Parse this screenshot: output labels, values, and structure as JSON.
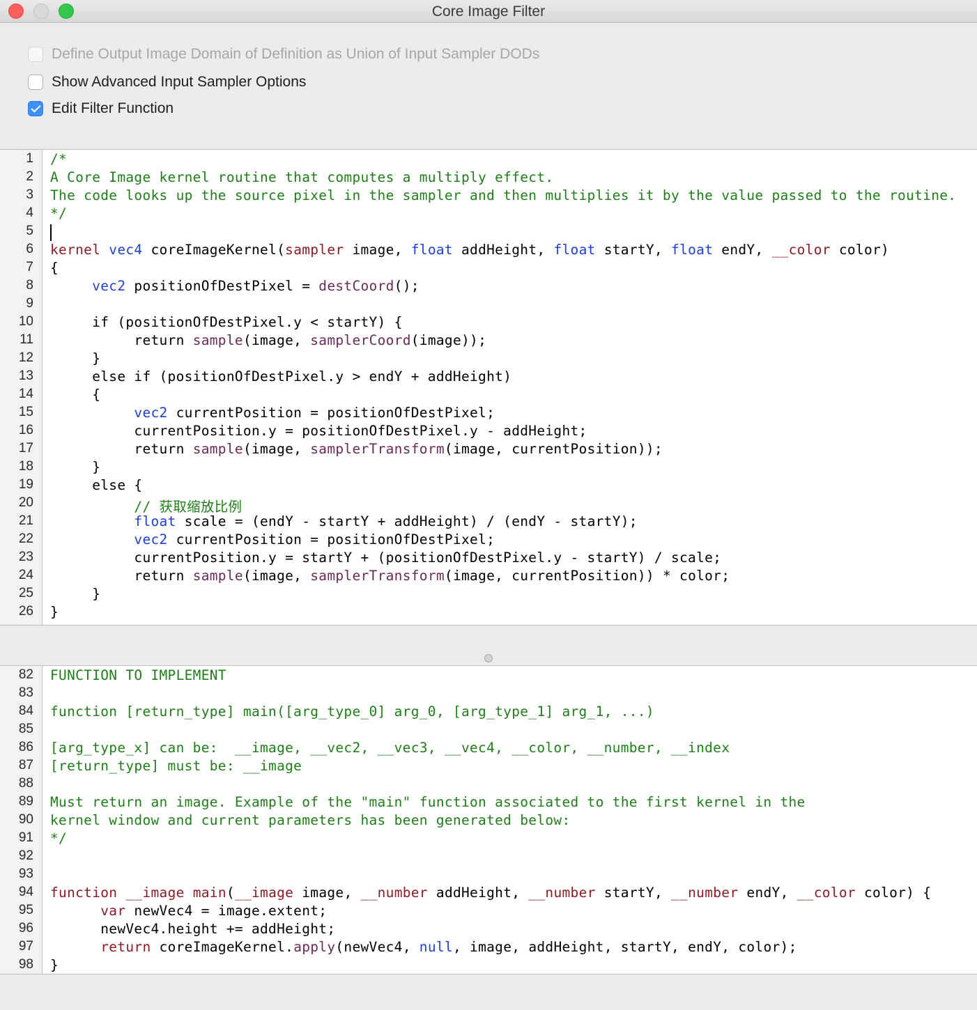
{
  "window": {
    "title": "Core Image Filter"
  },
  "options": [
    {
      "label": "Define Output Image Domain of Definition as Union of Input Sampler DODs",
      "checked": false,
      "disabled": true
    },
    {
      "label": "Show Advanced Input Sampler Options",
      "checked": false,
      "disabled": false
    },
    {
      "label": "Edit Filter Function",
      "checked": true,
      "disabled": false
    }
  ],
  "colors": {
    "comment": "#1f7e19",
    "keyword": "#8b1c25",
    "type": "#1e3ed6",
    "function": "#6a2a5a",
    "accent": "#3f8ff7"
  },
  "kernel_editor": {
    "lines": [
      {
        "n": "1",
        "tokens": [
          [
            "/*",
            "comment"
          ]
        ]
      },
      {
        "n": "2",
        "tokens": [
          [
            "A Core Image kernel routine that computes a multiply effect.",
            "comment"
          ]
        ]
      },
      {
        "n": "3",
        "tokens": [
          [
            "The code looks up the source pixel in the sampler and then multiplies it by the value passed to the routine.",
            "comment"
          ]
        ]
      },
      {
        "n": "4",
        "tokens": [
          [
            "*/",
            "comment"
          ]
        ]
      },
      {
        "n": "5",
        "tokens": []
      },
      {
        "n": "6",
        "tokens": [
          [
            "kernel",
            "kw"
          ],
          [
            " ",
            "plain"
          ],
          [
            "vec4",
            "type"
          ],
          [
            " coreImageKernel(",
            "plain"
          ],
          [
            "sampler",
            "kw"
          ],
          [
            " image, ",
            "plain"
          ],
          [
            "float",
            "type"
          ],
          [
            " addHeight, ",
            "plain"
          ],
          [
            "float",
            "type"
          ],
          [
            " startY, ",
            "plain"
          ],
          [
            "float",
            "type"
          ],
          [
            " endY, ",
            "plain"
          ],
          [
            "__color",
            "kw"
          ],
          [
            " color)",
            "plain"
          ]
        ]
      },
      {
        "n": "7",
        "tokens": [
          [
            "{",
            "plain"
          ]
        ]
      },
      {
        "n": "8",
        "tokens": [
          [
            "     ",
            "plain"
          ],
          [
            "vec2",
            "type"
          ],
          [
            " positionOfDestPixel = ",
            "plain"
          ],
          [
            "destCoord",
            "fn"
          ],
          [
            "();",
            "plain"
          ]
        ]
      },
      {
        "n": "9",
        "tokens": []
      },
      {
        "n": "10",
        "tokens": [
          [
            "     if (positionOfDestPixel.y < startY) {",
            "plain"
          ]
        ]
      },
      {
        "n": "11",
        "tokens": [
          [
            "          return ",
            "plain"
          ],
          [
            "sample",
            "fn"
          ],
          [
            "(image, ",
            "plain"
          ],
          [
            "samplerCoord",
            "fn"
          ],
          [
            "(image));",
            "plain"
          ]
        ]
      },
      {
        "n": "12",
        "tokens": [
          [
            "     }",
            "plain"
          ]
        ]
      },
      {
        "n": "13",
        "tokens": [
          [
            "     else if (positionOfDestPixel.y > endY + addHeight)",
            "plain"
          ]
        ]
      },
      {
        "n": "14",
        "tokens": [
          [
            "     {",
            "plain"
          ]
        ]
      },
      {
        "n": "15",
        "tokens": [
          [
            "          ",
            "plain"
          ],
          [
            "vec2",
            "type"
          ],
          [
            " currentPosition = positionOfDestPixel;",
            "plain"
          ]
        ]
      },
      {
        "n": "16",
        "tokens": [
          [
            "          currentPosition.y = positionOfDestPixel.y - addHeight;",
            "plain"
          ]
        ]
      },
      {
        "n": "17",
        "tokens": [
          [
            "          return ",
            "plain"
          ],
          [
            "sample",
            "fn"
          ],
          [
            "(image, ",
            "plain"
          ],
          [
            "samplerTransform",
            "fn"
          ],
          [
            "(image, currentPosition));",
            "plain"
          ]
        ]
      },
      {
        "n": "18",
        "tokens": [
          [
            "     }",
            "plain"
          ]
        ]
      },
      {
        "n": "19",
        "tokens": [
          [
            "     else {",
            "plain"
          ]
        ]
      },
      {
        "n": "20",
        "tokens": [
          [
            "          ",
            "plain"
          ],
          [
            "// 获取缩放比例",
            "comment"
          ]
        ]
      },
      {
        "n": "21",
        "tokens": [
          [
            "          ",
            "plain"
          ],
          [
            "float",
            "type"
          ],
          [
            " scale = (endY - startY + addHeight) / (endY - startY);",
            "plain"
          ]
        ]
      },
      {
        "n": "22",
        "tokens": [
          [
            "          ",
            "plain"
          ],
          [
            "vec2",
            "type"
          ],
          [
            " currentPosition = positionOfDestPixel;",
            "plain"
          ]
        ]
      },
      {
        "n": "23",
        "tokens": [
          [
            "          currentPosition.y = startY + (positionOfDestPixel.y - startY) / scale;",
            "plain"
          ]
        ]
      },
      {
        "n": "24",
        "tokens": [
          [
            "          return ",
            "plain"
          ],
          [
            "sample",
            "fn"
          ],
          [
            "(image, ",
            "plain"
          ],
          [
            "samplerTransform",
            "fn"
          ],
          [
            "(image, currentPosition)) * color;",
            "plain"
          ]
        ]
      },
      {
        "n": "25",
        "tokens": [
          [
            "     }",
            "plain"
          ]
        ]
      },
      {
        "n": "26",
        "tokens": [
          [
            "}",
            "plain"
          ]
        ]
      }
    ]
  },
  "function_editor": {
    "lines": [
      {
        "n": "82",
        "tokens": [
          [
            "FUNCTION TO IMPLEMENT",
            "comment"
          ]
        ]
      },
      {
        "n": "83",
        "tokens": []
      },
      {
        "n": "84",
        "tokens": [
          [
            "function [return_type] main([arg_type_0] arg_0, [arg_type_1] arg_1, ...)",
            "comment"
          ]
        ]
      },
      {
        "n": "85",
        "tokens": []
      },
      {
        "n": "86",
        "tokens": [
          [
            "[arg_type_x] can be:  __image, __vec2, __vec3, __vec4, __color, __number, __index",
            "comment"
          ]
        ]
      },
      {
        "n": "87",
        "tokens": [
          [
            "[return_type] must be: __image",
            "comment"
          ]
        ]
      },
      {
        "n": "88",
        "tokens": []
      },
      {
        "n": "89",
        "tokens": [
          [
            "Must return an image. Example of the \"main\" function associated to the first kernel in the",
            "comment"
          ]
        ]
      },
      {
        "n": "90",
        "tokens": [
          [
            "kernel window and current parameters has been generated below:",
            "comment"
          ]
        ]
      },
      {
        "n": "91",
        "tokens": [
          [
            "*/",
            "comment"
          ]
        ]
      },
      {
        "n": "92",
        "tokens": []
      },
      {
        "n": "93",
        "tokens": []
      },
      {
        "n": "94",
        "tokens": [
          [
            "function",
            "kw"
          ],
          [
            " ",
            "plain"
          ],
          [
            "__image",
            "kw"
          ],
          [
            " ",
            "plain"
          ],
          [
            "main",
            "kw"
          ],
          [
            "(",
            "plain"
          ],
          [
            "__image",
            "kw"
          ],
          [
            " image, ",
            "plain"
          ],
          [
            "__number",
            "kw"
          ],
          [
            " addHeight, ",
            "plain"
          ],
          [
            "__number",
            "kw"
          ],
          [
            " startY, ",
            "plain"
          ],
          [
            "__number",
            "kw"
          ],
          [
            " endY, ",
            "plain"
          ],
          [
            "__color",
            "kw"
          ],
          [
            " color) {",
            "plain"
          ]
        ]
      },
      {
        "n": "95",
        "tokens": [
          [
            "      ",
            "plain"
          ],
          [
            "var",
            "kw"
          ],
          [
            " newVec4 = image.extent;",
            "plain"
          ]
        ]
      },
      {
        "n": "96",
        "tokens": [
          [
            "      newVec4.height += addHeight;",
            "plain"
          ]
        ]
      },
      {
        "n": "97",
        "tokens": [
          [
            "      ",
            "plain"
          ],
          [
            "return",
            "kw"
          ],
          [
            " coreImageKernel.",
            "plain"
          ],
          [
            "apply",
            "fn"
          ],
          [
            "(newVec4, ",
            "plain"
          ],
          [
            "null",
            "type"
          ],
          [
            ", image, addHeight, startY, endY, color);",
            "plain"
          ]
        ]
      },
      {
        "n": "98",
        "tokens": [
          [
            "}",
            "plain"
          ]
        ]
      }
    ]
  }
}
